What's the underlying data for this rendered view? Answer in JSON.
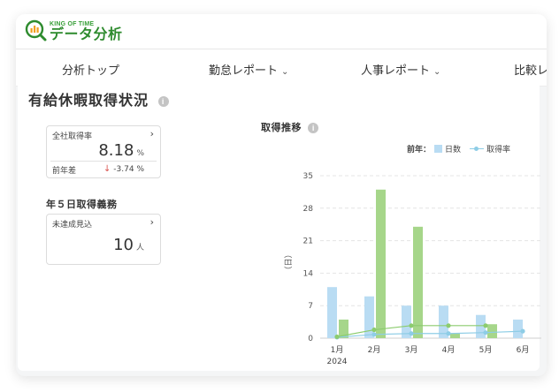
{
  "header": {
    "logo_sub": "KING OF TIME",
    "logo_main": "データ分析"
  },
  "nav": {
    "items": [
      {
        "label": "分析トップ",
        "has_chevron": false
      },
      {
        "label": "勤怠レポート",
        "has_chevron": true
      },
      {
        "label": "人事レポート",
        "has_chevron": true
      },
      {
        "label": "比較レ",
        "has_chevron": false
      }
    ]
  },
  "page": {
    "title": "有給休暇取得状況"
  },
  "card_rate": {
    "label": "全社取得率",
    "value": "8.18",
    "unit": "%",
    "diff_label": "前年差",
    "diff_value": "-3.74",
    "diff_unit": "%"
  },
  "obligation": {
    "section_label": "年５日取得義務",
    "card_label": "未達成見込",
    "value": "10",
    "unit": "人"
  },
  "chart_panel": {
    "title": "取得推移",
    "legend_prefix": "前年：",
    "legend_days": "日数",
    "legend_rate": "取得率"
  },
  "chart_data": {
    "type": "bar",
    "categories": [
      "1月",
      "2月",
      "3月",
      "4月",
      "5月",
      "6月"
    ],
    "year_label": "2024",
    "ylabel": "（日）",
    "yticks": [
      0,
      7,
      14,
      21,
      28,
      35
    ],
    "ylim": [
      0,
      35
    ],
    "grid": true,
    "series": [
      {
        "name": "日数",
        "kind": "bar",
        "color": "#b9dcf3",
        "values": [
          11,
          9,
          7,
          7,
          5,
          4
        ]
      },
      {
        "kind": "bar",
        "color": "#a6d68a",
        "values": [
          4,
          32,
          24,
          1,
          3,
          null
        ]
      },
      {
        "name": "取得率",
        "kind": "line",
        "color": "#8ecde6",
        "values": [
          0.2,
          0.8,
          1.0,
          1.0,
          1.2,
          1.5
        ]
      },
      {
        "kind": "line",
        "color": "#8ccc6e",
        "values": [
          0.3,
          1.8,
          2.7,
          2.7,
          2.7,
          null
        ]
      }
    ]
  }
}
